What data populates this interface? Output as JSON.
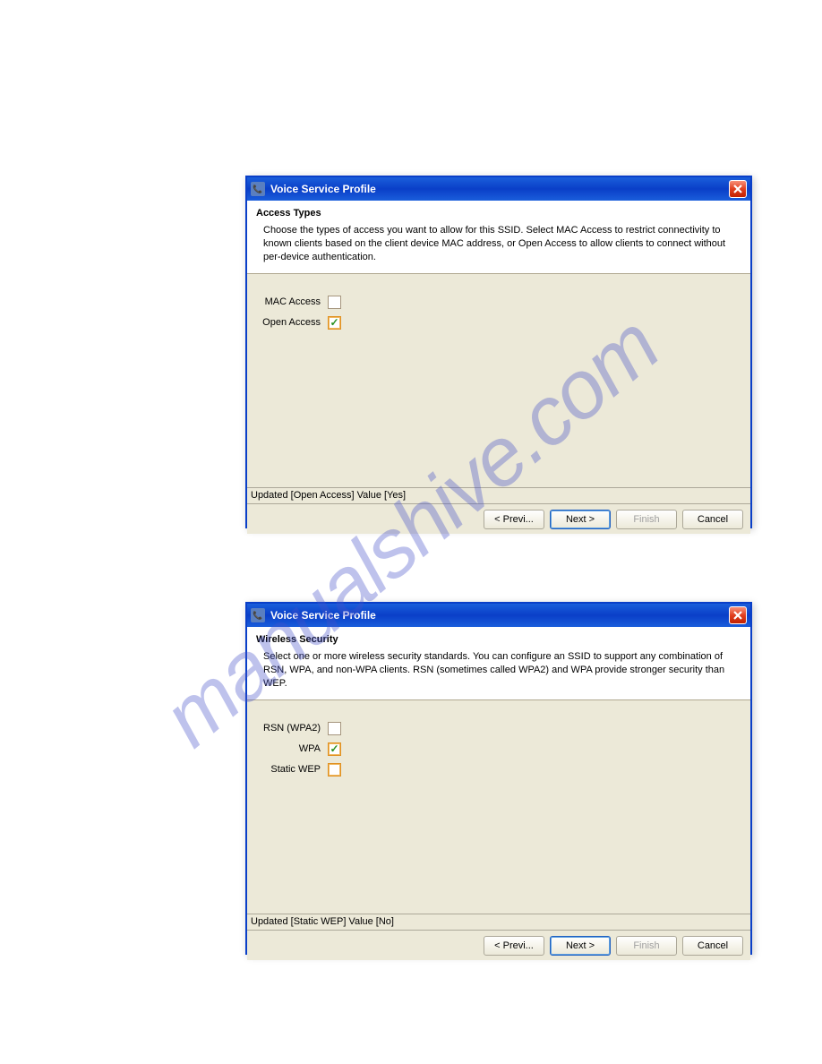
{
  "watermark": "manualshive.com",
  "dialog1": {
    "title": "Voice Service Profile",
    "section_title": "Access Types",
    "description": "Choose the types of access you want to allow for this SSID. Select MAC Access to restrict connectivity to known clients based on the client device MAC address, or Open Access to allow clients to connect without per-device authentication.",
    "fields": {
      "mac_access": {
        "label": "MAC Access",
        "checked": false
      },
      "open_access": {
        "label": "Open Access",
        "checked": true
      }
    },
    "status": "Updated [Open Access] Value [Yes]",
    "buttons": {
      "prev": "< Previ...",
      "next": "Next >",
      "finish": "Finish",
      "cancel": "Cancel"
    }
  },
  "dialog2": {
    "title": "Voice Service Profile",
    "section_title": "Wireless Security",
    "description": "Select one or more wireless security standards. You can configure an SSID to support any combination of RSN, WPA, and non-WPA clients. RSN (sometimes called WPA2) and WPA provide stronger security than WEP.",
    "fields": {
      "rsn_wpa2": {
        "label": "RSN (WPA2)",
        "checked": false
      },
      "wpa": {
        "label": "WPA",
        "checked": true
      },
      "static_wep": {
        "label": "Static WEP",
        "checked": false
      }
    },
    "status": "Updated [Static WEP] Value [No]",
    "buttons": {
      "prev": "< Previ...",
      "next": "Next >",
      "finish": "Finish",
      "cancel": "Cancel"
    }
  }
}
